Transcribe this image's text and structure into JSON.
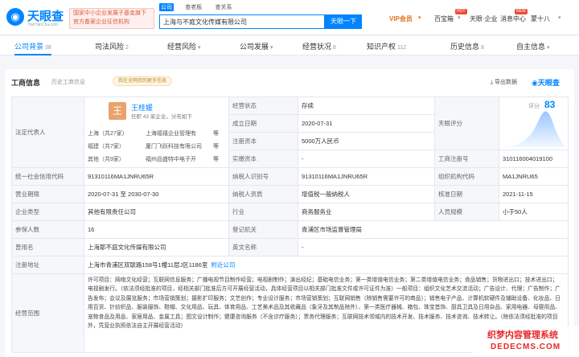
{
  "header": {
    "logo_text": "天眼查",
    "logo_sub": "TianYanCha.com",
    "ad_line1": "国家中小企业发展子基金旗下",
    "ad_line2": "官方备案企业征信机构",
    "search_tabs": [
      "公司",
      "查老板",
      "查关系"
    ],
    "search_value": "上海与不庭文化传媒有限公司",
    "search_button": "天眼一下",
    "vip": "VIP会员",
    "baibao": "百宝箱",
    "app": "天眼·企业",
    "messages": "消息中心",
    "user": "蒙十八"
  },
  "tabs": [
    {
      "label": "公司背景",
      "count": "38"
    },
    {
      "label": "司法风险",
      "count": "2"
    },
    {
      "label": "经营风险",
      "count": ""
    },
    {
      "label": "公司发展",
      "count": ""
    },
    {
      "label": "经营状况",
      "count": "8"
    },
    {
      "label": "知识产权",
      "count": "112"
    },
    {
      "label": "历史信息",
      "count": "8"
    },
    {
      "label": "自主信息",
      "count": ""
    }
  ],
  "section": {
    "title": "工商信息",
    "history": "历史工商信息",
    "pill": "我在全网找到更多信息",
    "export": "导出数据",
    "brand": "天眼查"
  },
  "rep": {
    "label": "法定代表人",
    "avatar": "王",
    "name": "王桂媛",
    "sub": "任职 43 家企业，分布如下",
    "rows": [
      [
        "上海（共27家）",
        "上海福禧企业管理有",
        "等"
      ],
      [
        "福建（共7家）",
        "厦门飞跃科技有限公司",
        "等"
      ],
      [
        "其他（共9家）",
        "福州品盛特中电子开",
        "等"
      ]
    ]
  },
  "score": {
    "label": "评分",
    "value": "83",
    "tianyan_label": "天眼评分"
  },
  "rows": [
    {
      "l1": "经营状态",
      "v1": "存续"
    },
    {
      "l1": "成立日期",
      "v1": "2020-07-31"
    },
    {
      "l1": "注册资本",
      "v1": "5000万人民币"
    },
    {
      "l1": "实缴资本",
      "v1": "-",
      "l2": "工商注册号",
      "v2": "310116004019100"
    },
    {
      "l0": "统一社会信用代码",
      "v0": "91310116MA1JNRU65R",
      "l1": "纳税人识别号",
      "v1": "91310116MA1JNRU65R",
      "l2": "组织机构代码",
      "v2": "MA1JNRU65"
    },
    {
      "l0": "营业期限",
      "v0": "2020-07-31 至 2030-07-30",
      "l1": "纳税人资质",
      "v1": "增值税一般纳税人",
      "l2": "核准日期",
      "v2": "2021-11-15"
    },
    {
      "l0": "企业类型",
      "v0": "其他有限责任公司",
      "l1": "行业",
      "v1": "商务服务业",
      "l2": "人员规模",
      "v2": "小于50人"
    },
    {
      "l0": "参保人数",
      "v0": "16",
      "l1": "登记机关",
      "v1": "青浦区市场监督管理局"
    },
    {
      "l0": "曾用名",
      "v0": "上海耶不庭文化传媒有限公司",
      "l1": "英文名称",
      "v1": "-"
    },
    {
      "l0": "注册地址",
      "v0": "上海市青浦区双联路158号1幢11层J区1186室",
      "v0link": "附近公司"
    }
  ],
  "scope": {
    "label": "经营范围",
    "text": "许可项目：网络文化经营；互联网信息服务；广播电视节目制作经营；电视剧制作；演出经纪；基础电信业务；第一类增值电信业务；第二类增值电信业务；食品销售；货物进出口；技术进出口；电视剧发行。（依法须经批准的项目，经相关部门批准后方可开展经营活动，具体经营项目以相关部门批准文件或许可证件为准）一般项目：组织文化艺术交流活动；广告设计、代理；广告制作；广告发布；会议及展览服务；市场营销策划；摄影扩印服务；文艺创作；专业设计服务；市场营销策划；互联网销售（除销售需要许可的商品）；销售电子产品、计算机软硬件及辅助设备、化妆品、日用百货、针纺织品、服装服饰、鞋帽、文化用品、玩具、体育用品、工艺美术品及其收藏品（象牙及其制品除外）、第一类医疗器械、箱包、珠宝首饰、厨具卫具及日用杂品、家用电器、母婴用品、宠物食品及用品、家居用品、金属工具；图文设计制作；健康咨询服务（不含诊疗服务）；票务代理服务；互联网技术领域内的技术开发、技术服务、技术咨询、技术转让。（除依法须经批准的项目外，凭营业执照依法自主开展经营活动）"
  },
  "watermark": {
    "line1": "织梦内容管理系统",
    "line2": "DEDECMS.COM"
  }
}
